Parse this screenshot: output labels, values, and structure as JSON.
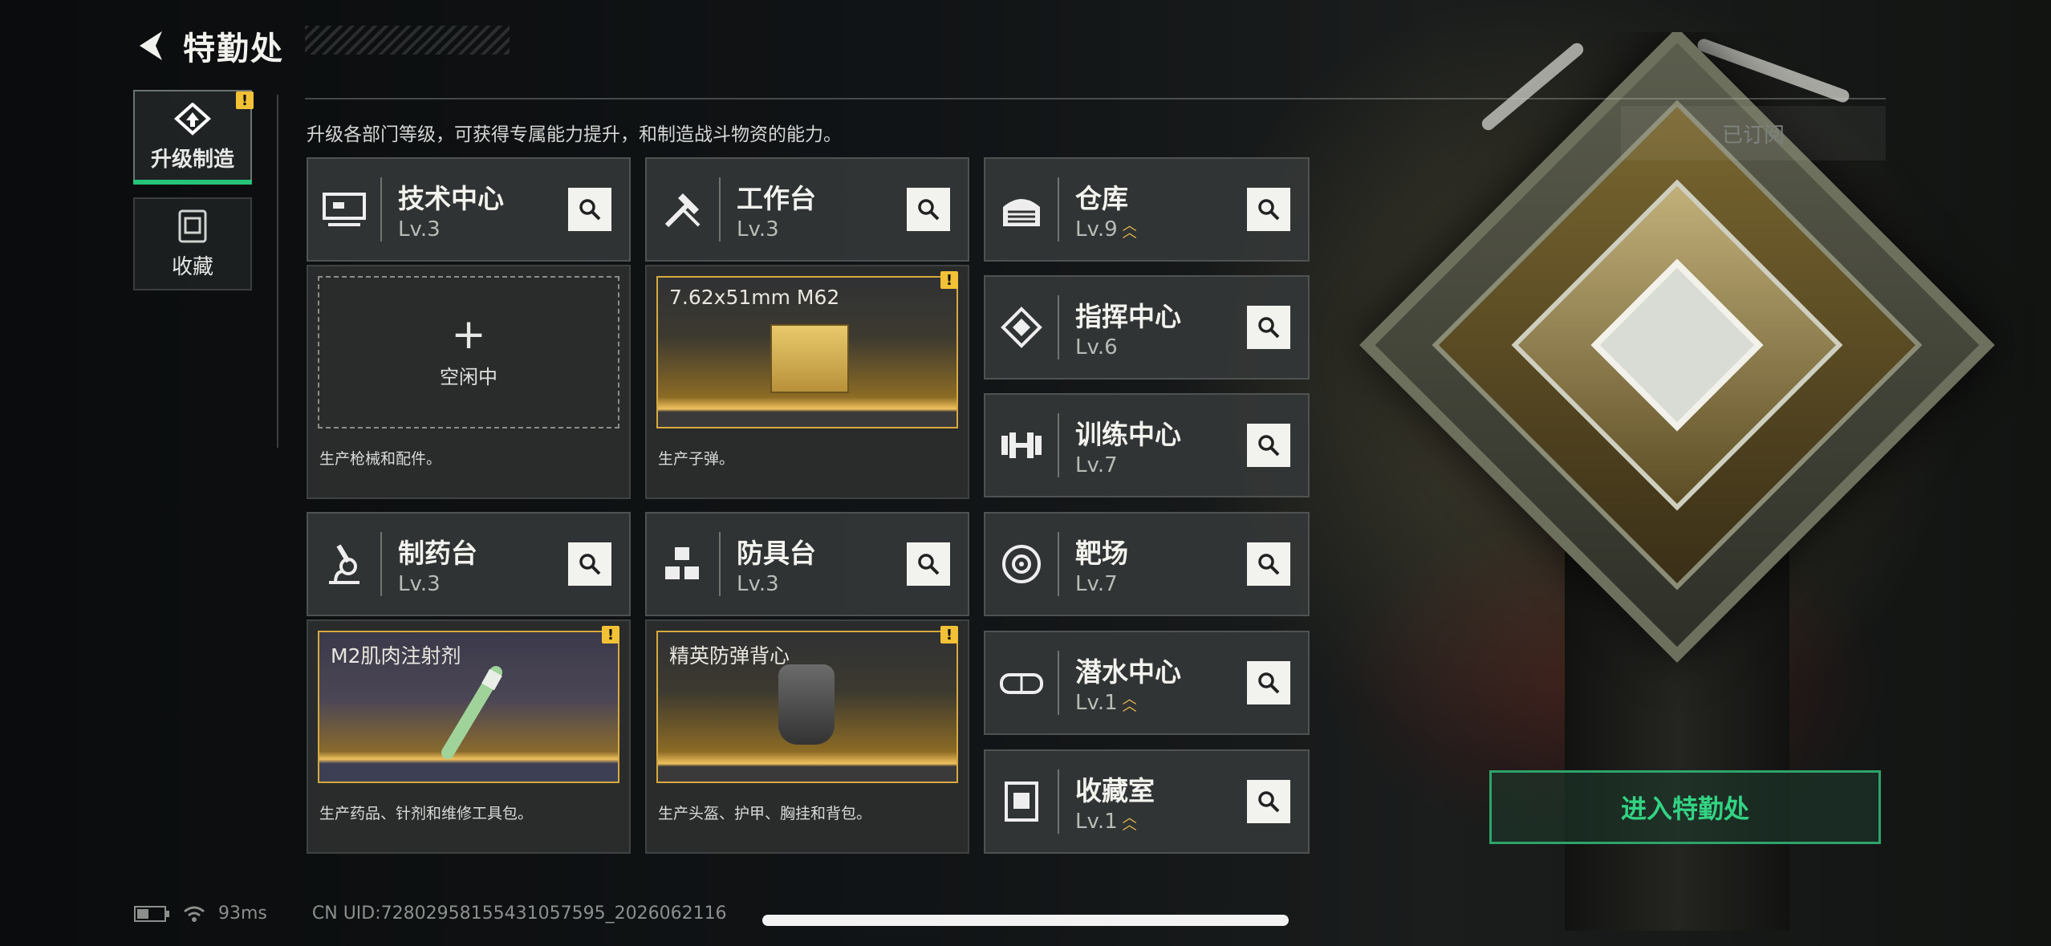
{
  "header": {
    "title": "特勤处"
  },
  "sidebar": {
    "items": [
      {
        "label": "升级制造",
        "active": true
      },
      {
        "label": "收藏",
        "active": false
      }
    ]
  },
  "description": "升级各部门等级，可获得专属能力提升，和制造战斗物资的能力。",
  "subscribed_label": "已订阅",
  "departments": {
    "tech": {
      "name": "技术中心",
      "level": "Lv.3"
    },
    "workbench": {
      "name": "工作台",
      "level": "Lv.3"
    },
    "pharmacy": {
      "name": "制药台",
      "level": "Lv.3"
    },
    "armor": {
      "name": "防具台",
      "level": "Lv.3"
    },
    "warehouse": {
      "name": "仓库",
      "level": "Lv.9"
    },
    "command": {
      "name": "指挥中心",
      "level": "Lv.6"
    },
    "training": {
      "name": "训练中心",
      "level": "Lv.7"
    },
    "range": {
      "name": "靶场",
      "level": "Lv.7"
    },
    "diving": {
      "name": "潜水中心",
      "level": "Lv.1"
    },
    "collection": {
      "name": "收藏室",
      "level": "Lv.1"
    }
  },
  "production": {
    "tech": {
      "idle_label": "空闲中",
      "footer": "生产枪械和配件。"
    },
    "workbench": {
      "item": "7.62x51mm M62",
      "footer": "生产子弹。"
    },
    "pharmacy": {
      "item": "M2肌肉注射剂",
      "footer": "生产药品、针剂和维修工具包。"
    },
    "armor": {
      "item": "精英防弹背心",
      "footer": "生产头盔、护甲、胸挂和背包。"
    }
  },
  "enter_button": "进入特勤处",
  "status": {
    "ping": "93ms",
    "uid": "CN UID:7280295815543105759​5_2026062116"
  },
  "colors": {
    "accent_green": "#25c47a",
    "warning_yellow": "#f3c136",
    "gold": "#d7a93f"
  }
}
